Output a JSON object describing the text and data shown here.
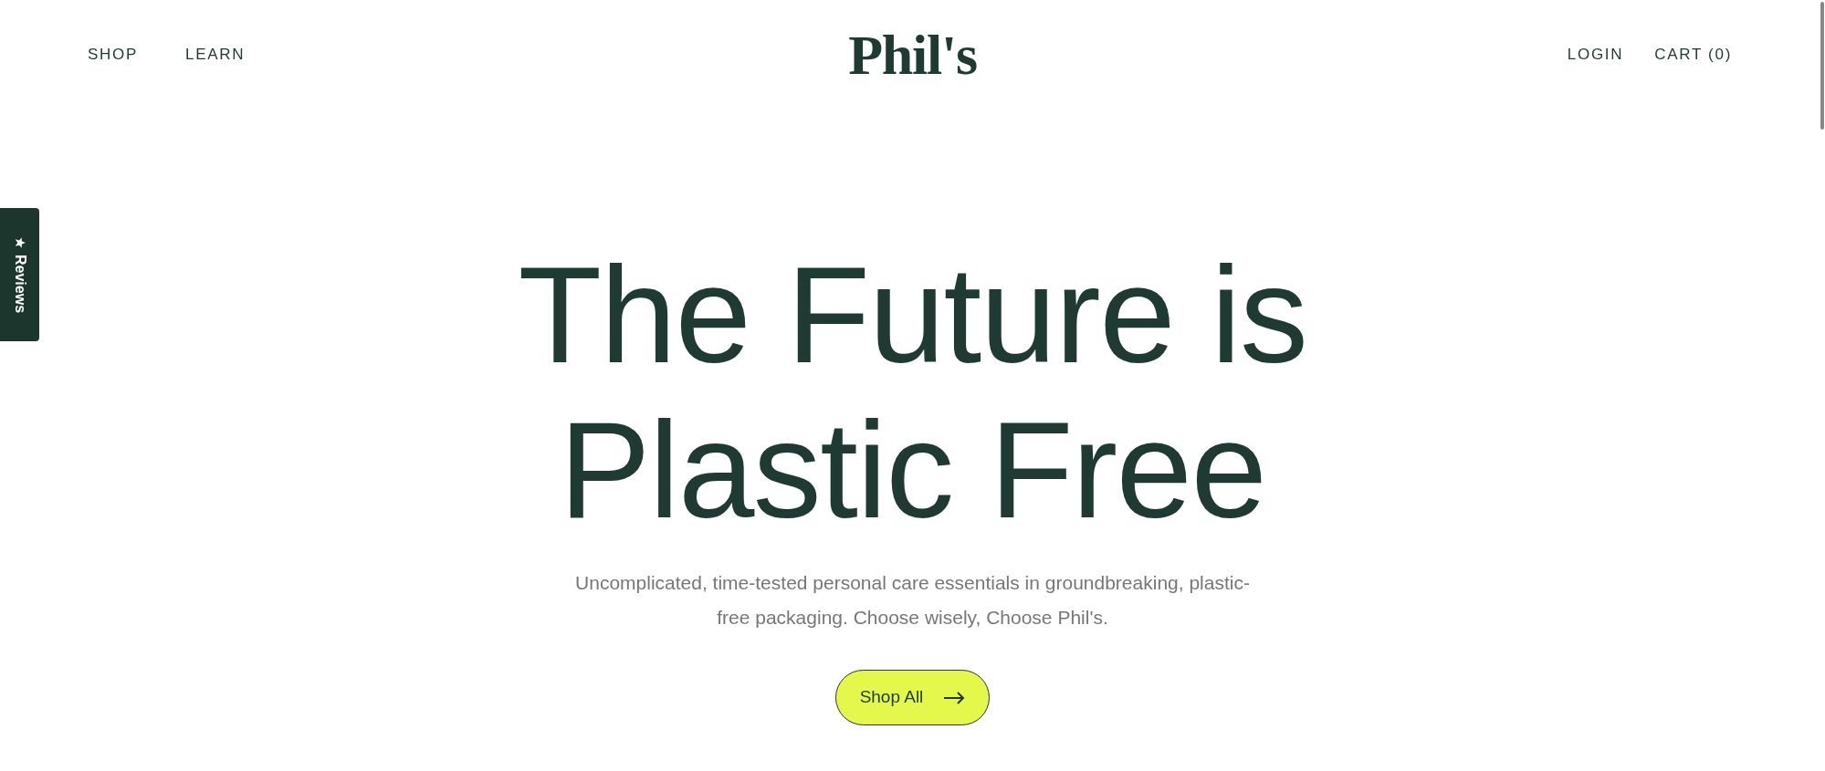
{
  "header": {
    "nav_left": [
      "SHOP",
      "LEARN"
    ],
    "logo": "Phil's",
    "nav_right": [
      "LOGIN",
      "CART (0)"
    ]
  },
  "reviews_tab": {
    "label": "Reviews"
  },
  "hero": {
    "title": "The Future is Plastic Free",
    "subtitle": "Uncomplicated, time-tested personal care essentials in groundbreaking, plastic-free packaging. Choose wisely, Choose Phil's.",
    "button": "Shop All"
  }
}
